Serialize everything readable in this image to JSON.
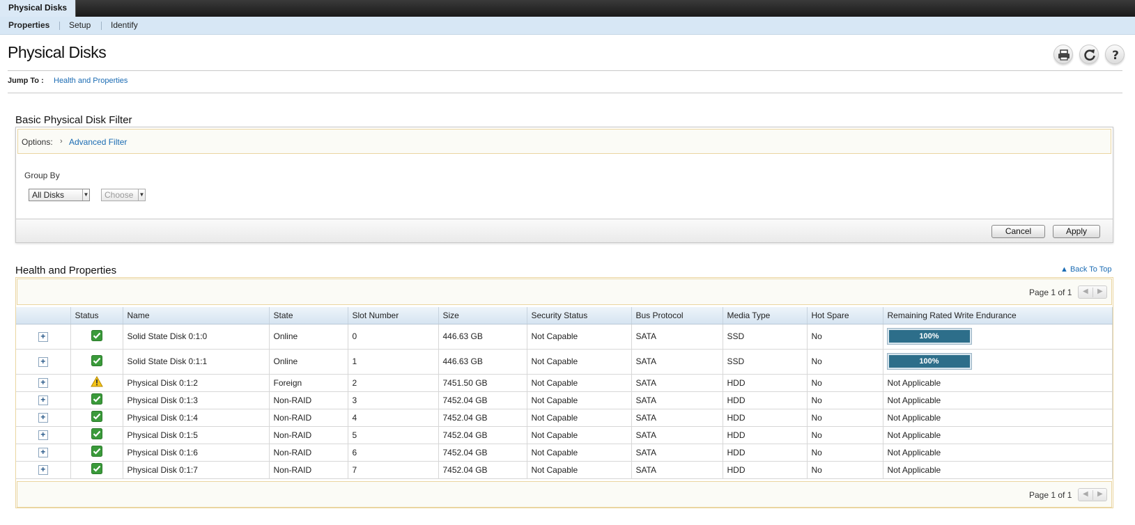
{
  "tab": {
    "label": "Physical Disks"
  },
  "subnav": {
    "items": [
      "Properties",
      "Setup",
      "Identify"
    ]
  },
  "page_title": "Physical Disks",
  "jump": {
    "label": "Jump To :",
    "link": "Health and Properties"
  },
  "filter": {
    "title": "Basic Physical Disk Filter",
    "options_label": "Options:",
    "advanced_link": "Advanced Filter",
    "group_by_label": "Group By",
    "group_by_value": "All Disks",
    "choose_value": "Choose",
    "cancel": "Cancel",
    "apply": "Apply"
  },
  "health": {
    "title": "Health and Properties",
    "back_to_top": "Back To Top",
    "pager_text": "Page 1 of 1",
    "columns": [
      "Status",
      "Name",
      "State",
      "Slot Number",
      "Size",
      "Security Status",
      "Bus Protocol",
      "Media Type",
      "Hot Spare",
      "Remaining Rated Write Endurance"
    ],
    "rows": [
      {
        "status": "ok",
        "name": "Solid State Disk 0:1:0",
        "state": "Online",
        "slot": "0",
        "size": "446.63 GB",
        "security": "Not Capable",
        "bus": "SATA",
        "media": "SSD",
        "hotspare": "No",
        "endurance": "100%",
        "endurance_fraction": 1.0
      },
      {
        "status": "ok",
        "name": "Solid State Disk 0:1:1",
        "state": "Online",
        "slot": "1",
        "size": "446.63 GB",
        "security": "Not Capable",
        "bus": "SATA",
        "media": "SSD",
        "hotspare": "No",
        "endurance": "100%",
        "endurance_fraction": 1.0
      },
      {
        "status": "warning",
        "name": "Physical Disk 0:1:2",
        "state": "Foreign",
        "slot": "2",
        "size": "7451.50 GB",
        "security": "Not Capable",
        "bus": "SATA",
        "media": "HDD",
        "hotspare": "No",
        "endurance": "Not Applicable"
      },
      {
        "status": "ok",
        "name": "Physical Disk 0:1:3",
        "state": "Non-RAID",
        "slot": "3",
        "size": "7452.04 GB",
        "security": "Not Capable",
        "bus": "SATA",
        "media": "HDD",
        "hotspare": "No",
        "endurance": "Not Applicable"
      },
      {
        "status": "ok",
        "name": "Physical Disk 0:1:4",
        "state": "Non-RAID",
        "slot": "4",
        "size": "7452.04 GB",
        "security": "Not Capable",
        "bus": "SATA",
        "media": "HDD",
        "hotspare": "No",
        "endurance": "Not Applicable"
      },
      {
        "status": "ok",
        "name": "Physical Disk 0:1:5",
        "state": "Non-RAID",
        "slot": "5",
        "size": "7452.04 GB",
        "security": "Not Capable",
        "bus": "SATA",
        "media": "HDD",
        "hotspare": "No",
        "endurance": "Not Applicable"
      },
      {
        "status": "ok",
        "name": "Physical Disk 0:1:6",
        "state": "Non-RAID",
        "slot": "6",
        "size": "7452.04 GB",
        "security": "Not Capable",
        "bus": "SATA",
        "media": "HDD",
        "hotspare": "No",
        "endurance": "Not Applicable"
      },
      {
        "status": "ok",
        "name": "Physical Disk 0:1:7",
        "state": "Non-RAID",
        "slot": "7",
        "size": "7452.04 GB",
        "security": "Not Capable",
        "bus": "SATA",
        "media": "HDD",
        "hotspare": "No",
        "endurance": "Not Applicable"
      }
    ]
  },
  "icons": {
    "print": "printer-icon",
    "refresh": "refresh-icon",
    "help": "help-icon"
  },
  "colors": {
    "accent_link": "#1a6bb3",
    "progress_fill": "#2d6e8a",
    "status_ok": "#3a9a3a",
    "status_warning": "#f0b400"
  }
}
